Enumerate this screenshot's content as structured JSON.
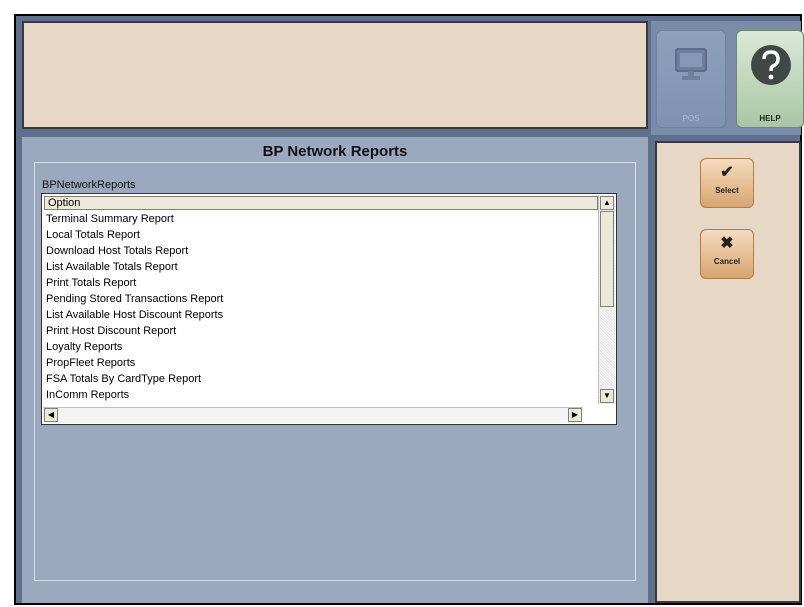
{
  "message_area": "",
  "toolbar": {
    "pos_label": "POS",
    "help_label": "HELP"
  },
  "main": {
    "title": "BP Network Reports",
    "list_label": "BPNetworkReports",
    "column_header": "Option",
    "options": [
      "Terminal Summary Report",
      "Local Totals Report",
      "Download Host Totals Report",
      "List Available Totals Report",
      "Print Totals Report",
      "Pending Stored Transactions Report",
      "List Available Host Discount Reports",
      "Print Host Discount Report",
      "Loyalty Reports",
      "PropFleet Reports",
      "FSA Totals By CardType Report",
      "InComm Reports"
    ]
  },
  "actions": {
    "select_label": "Select",
    "cancel_label": "Cancel"
  },
  "colors": {
    "background": "#5f6f8e",
    "panel": "#9ba9bf",
    "beige": "#e6d8c4",
    "button": "#d8a56f"
  }
}
